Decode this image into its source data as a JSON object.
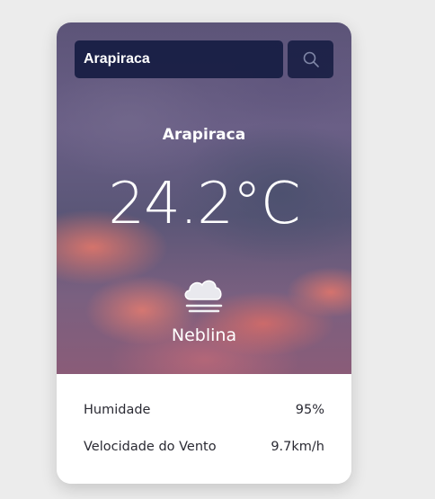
{
  "search": {
    "value": "Arapiraca",
    "icon": "search-icon"
  },
  "weather": {
    "city": "Arapiraca",
    "temperature": "24.2°C",
    "condition": "Neblina",
    "condition_icon": "fog-icon"
  },
  "details": {
    "humidity_label": "Humidade",
    "humidity_value": "95%",
    "wind_label": "Velocidade do Vento",
    "wind_value": "9.7km/h"
  },
  "colors": {
    "search_bg": "#161c42",
    "page_bg": "#ececec",
    "text_dark": "#2a2a33"
  }
}
